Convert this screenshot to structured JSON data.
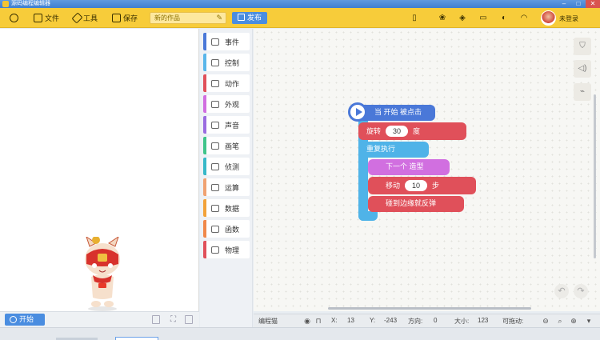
{
  "window": {
    "title": "源码编程编辑器",
    "min": "–",
    "max": "□",
    "close": "✕"
  },
  "toolbar": {
    "file": "文件",
    "tools": "工具",
    "save": "保存",
    "project_name": "新的作品",
    "publish": "发布",
    "login": "未登录"
  },
  "stage": {
    "start": "开始"
  },
  "categories": [
    {
      "label": "事件",
      "color": "#4a78d8"
    },
    {
      "label": "控制",
      "color": "#5ab6ea"
    },
    {
      "label": "动作",
      "color": "#e0505a"
    },
    {
      "label": "外观",
      "color": "#d16fe0"
    },
    {
      "label": "声音",
      "color": "#9a6ce0"
    },
    {
      "label": "画笔",
      "color": "#3fc48a"
    },
    {
      "label": "侦测",
      "color": "#37b8c8"
    },
    {
      "label": "运算",
      "color": "#f0a272"
    },
    {
      "label": "数据",
      "color": "#f2a23a"
    },
    {
      "label": "函数",
      "color": "#f0884a"
    },
    {
      "label": "物理",
      "color": "#e0505a"
    }
  ],
  "blocks": {
    "hat": "当 开始 被点击",
    "turn": "旋转",
    "turn_value": "30",
    "turn_unit": "度",
    "repeat": "重复执行",
    "next_costume": "下一个 造型",
    "move": "移动",
    "move_value": "10",
    "move_unit": "步",
    "bounce": "碰到边缘就反弹"
  },
  "status": {
    "sprite": "编程猫",
    "x_label": "X:",
    "x": "13",
    "y_label": "Y:",
    "y": "-243",
    "direction_label": "方向:",
    "direction": "0",
    "size_label": "大小:",
    "size": "123",
    "draggable_label": "可拖动:"
  },
  "colors": {
    "toolbar": "#f7cc3a",
    "accent": "#4a8de0",
    "event": "#4a78d8",
    "control": "#4fb3e8",
    "motion": "#e0505a",
    "looks": "#d16fe0"
  }
}
